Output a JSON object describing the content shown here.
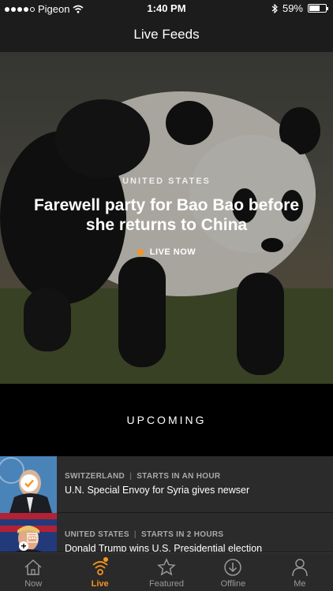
{
  "status_bar": {
    "carrier": "Pigeon",
    "time": "1:40 PM",
    "battery": "59%",
    "battery_level": 0.59,
    "signal_bars": 4,
    "icons": [
      "signal-icon",
      "wifi-icon",
      "bluetooth-icon",
      "battery-icon"
    ]
  },
  "nav": {
    "title": "Live Feeds"
  },
  "hero": {
    "region": "UNITED STATES",
    "title": "Farewell party for Bao Bao before she returns to China",
    "live_label": "LIVE NOW",
    "live_color": "#f7931e"
  },
  "upcoming": {
    "label": "UPCOMING",
    "items": [
      {
        "region": "SWITZERLAND",
        "time": "STARTS IN AN HOUR",
        "title": "U.N. Special Envoy for Syria gives newser",
        "badge": "check-icon"
      },
      {
        "region": "UNITED STATES",
        "time": "STARTS IN 2 HOURS",
        "title": "Donald Trump wins U.S. Presidential election",
        "badge": "calendar-add-icon"
      }
    ]
  },
  "tabs": [
    {
      "label": "Now",
      "icon": "home-icon",
      "active": false
    },
    {
      "label": "Live",
      "icon": "live-broadcast-icon",
      "active": true
    },
    {
      "label": "Featured",
      "icon": "star-icon",
      "active": false
    },
    {
      "label": "Offline",
      "icon": "download-icon",
      "active": false
    },
    {
      "label": "Me",
      "icon": "person-icon",
      "active": false
    }
  ],
  "colors": {
    "accent": "#f7931e",
    "background": "#000000",
    "bar": "#1c1c1c",
    "row": "#2b2b2b"
  }
}
